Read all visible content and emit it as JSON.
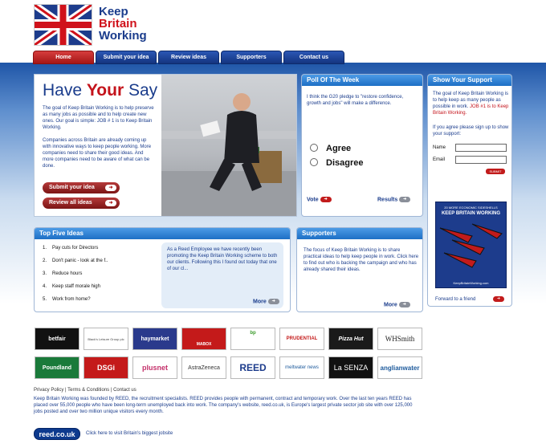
{
  "logo": {
    "line1": "Keep",
    "line2": "Britain",
    "line3": "Working"
  },
  "nav": {
    "tabs": [
      {
        "label": "Home",
        "active": true
      },
      {
        "label": "Submit your idea",
        "active": false
      },
      {
        "label": "Review ideas",
        "active": false
      },
      {
        "label": "Supporters",
        "active": false
      },
      {
        "label": "Contact us",
        "active": false
      }
    ]
  },
  "hero": {
    "title_1": "Have ",
    "title_2": "Your",
    "title_3": " Say",
    "para_1": "The goal of Keep Britain Working is to help preserve as many jobs as possible and to help create new ones. Our goal is simple: JOB # 1 is to Keep Britain Working.",
    "para_2": "Companies across Britain are already coming up with innovative ways to keep people working. More companies need to share their good ideas. And more companies need to be aware of what can be done.",
    "submit_label": "Submit your idea",
    "review_label": "Review all ideas"
  },
  "poll": {
    "header": "Poll Of The Week",
    "question": "I think the G20 pledge to \"restore confidence, growth and jobs\" will make a difference.",
    "option_1": "Agree",
    "option_2": "Disagree",
    "vote_label": "Vote",
    "results_label": "Results"
  },
  "support": {
    "header": "Show Your Support",
    "intro_1": "The goal of Keep Britain Working is to help keep as many people as possible in work.",
    "intro_red": "JOB #1 is to Keep Britain Working.",
    "intro_2": "If you agree please sign up to show your support:",
    "name_label": "Name",
    "email_label": "Email",
    "submit_label": "SUBMIT",
    "poster_top": "20 MORE ECONOMIC SIDESHELLS",
    "poster_title": "KEEP BRITAIN WORKING",
    "poster_url": "KeepBritainWorking.com",
    "forward_label": "Forward to a friend"
  },
  "top_five": {
    "header": "Top Five Ideas",
    "items": [
      {
        "num": "1.",
        "label": "Pay cuts for Directors"
      },
      {
        "num": "2.",
        "label": "Don't panic - look at the f.."
      },
      {
        "num": "3.",
        "label": "Reduce hours"
      },
      {
        "num": "4.",
        "label": "Keep staff morale high"
      },
      {
        "num": "5.",
        "label": "Work from home?"
      }
    ],
    "quote": "As a Reed Employee we have recently been promoting the Keep Britain Working scheme to both our clients. Following this I found out today that one of our cl...",
    "more_label": "More"
  },
  "supporters": {
    "header": "Supporters",
    "text": "The focus of Keep Britain Working is to share practical ideas to help keep people in work. Click here to find out who is backing the campaign and who has already shared their ideas.",
    "more_label": "More"
  },
  "sponsors": {
    "row1": [
      "betfair",
      "Black's Leisure Group plc",
      "haymarket",
      "MABOX",
      "bp",
      "PRUDENTIAL",
      "Pizza Hut",
      "WHSmith"
    ],
    "row2": [
      "Poundland",
      "DSGi",
      "plusnet",
      "AstraZeneca",
      "REED",
      "meltwater news",
      "La SENZA",
      "anglianwater"
    ]
  },
  "footer": {
    "privacy": "Privacy Policy",
    "sep1": " | ",
    "terms": "Terms & Conditions",
    "sep2": " | ",
    "contact": "Contact us",
    "text": "Keep Britain Working was founded by REED, the recruitment specialists. REED provides people with permanent, contract and temporary work. Over the last ten years REED has placed over 55,000 people who have been long-term unemployed back into work. The company's website, reed.co.uk, is Europe's largest private sector job site with over 125,000 jobs posted and over two million unique visitors every month.",
    "reed_badge": "reed.co.uk",
    "reed_link": "Click here to visit Britain's biggest jobsite"
  }
}
